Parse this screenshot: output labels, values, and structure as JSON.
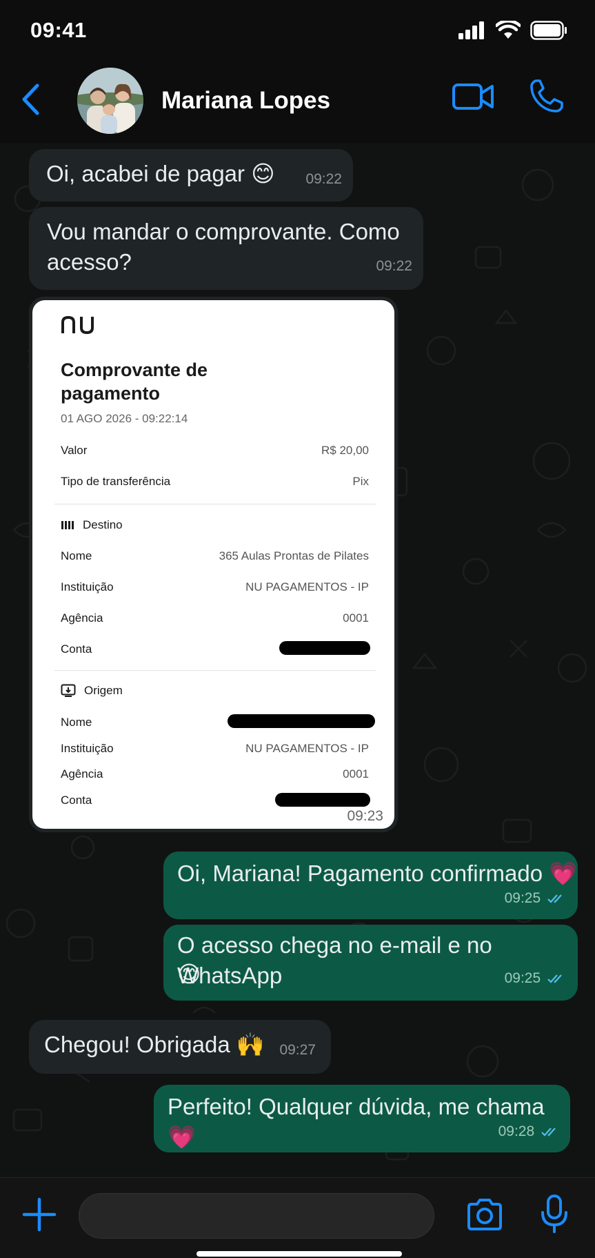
{
  "status_bar": {
    "time": "09:41"
  },
  "header": {
    "contact_name": "Mariana Lopes"
  },
  "messages": [
    {
      "dir": "in",
      "text": "Oi, acabei de pagar 😊",
      "time": "09:22"
    },
    {
      "dir": "in",
      "text_line1": "Vou mandar o comprovante. Como",
      "text_line2": "acesso?",
      "time": "09:22"
    },
    {
      "dir": "out",
      "text": "Oi, Mariana! Pagamento confirmado 💗",
      "time": "09:25"
    },
    {
      "dir": "out",
      "text_line1": "O acesso chega no e-mail e no WhatsApp",
      "text_line2": "😊",
      "time": "09:25"
    },
    {
      "dir": "in",
      "text": "Chegou! Obrigada 🙌",
      "time": "09:27"
    },
    {
      "dir": "out",
      "text": "Perfeito! Qualquer dúvida, me chama 💗",
      "time": "09:28"
    }
  ],
  "receipt": {
    "logo": "nu",
    "title": "Comprovante de pagamento",
    "date": "01 AGO 2026 - 09:22:14",
    "valor_label": "Valor",
    "valor": "R$ 20,00",
    "tipo_label": "Tipo de transferência",
    "tipo": "Pix",
    "destino_label": "Destino",
    "destino": {
      "nome_label": "Nome",
      "nome": "365 Aulas Prontas de Pilates",
      "inst_label": "Instituição",
      "inst": "NU PAGAMENTOS - IP",
      "agencia_label": "Agência",
      "agencia": "0001",
      "conta_label": "Conta"
    },
    "origem_label": "Origem",
    "origem": {
      "nome_label": "Nome",
      "inst_label": "Instituição",
      "inst": "NU PAGAMENTOS - IP",
      "agencia_label": "Agência",
      "agencia": "0001",
      "conta_label": "Conta"
    },
    "time": "09:23"
  },
  "composer": {
    "placeholder": ""
  },
  "colors": {
    "accent": "#1a8cff",
    "bubble_out": "#0c5a45",
    "bubble_in": "#1f2427",
    "ticks": "#53bdeb"
  }
}
